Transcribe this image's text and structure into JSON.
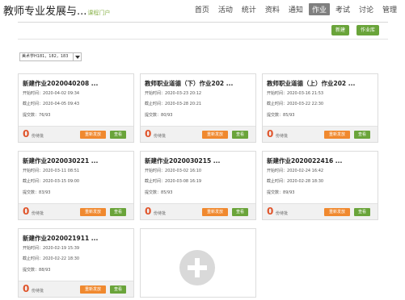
{
  "header": {
    "course_title": "教师专业发展与...",
    "course_subtitle": "课程门户",
    "nav": [
      {
        "label": "首页",
        "active": false
      },
      {
        "label": "活动",
        "active": false
      },
      {
        "label": "统计",
        "active": false
      },
      {
        "label": "资料",
        "active": false
      },
      {
        "label": "通知",
        "active": false
      },
      {
        "label": "作业",
        "active": true
      },
      {
        "label": "考试",
        "active": false
      },
      {
        "label": "讨论",
        "active": false
      },
      {
        "label": "管理",
        "active": false
      }
    ]
  },
  "toolbar": {
    "new_label": "新建",
    "library_label": "作业库"
  },
  "class_select": {
    "selected": "美术学H181，182，183"
  },
  "labels": {
    "start_prefix": "开始时间：",
    "end_prefix": "截止时间：",
    "submitted_prefix": "提交数：",
    "pending_label": "份待批",
    "publish_label": "重新发放",
    "view_label": "查看"
  },
  "cards": [
    {
      "title": "新建作业2020040208 ...",
      "start": "2020-04-02 09:34",
      "end": "2020-04-05 09:43",
      "submitted": "76/93",
      "pending": "0"
    },
    {
      "title": "教师职业道德（下）作业202 ...",
      "start": "2020-03-23 20:12",
      "end": "2020-03-28 20:21",
      "submitted": "80/93",
      "pending": "0"
    },
    {
      "title": "教师职业道德（上）作业202 ...",
      "start": "2020-03-16 21:53",
      "end": "2020-03-22 22:30",
      "submitted": "85/93",
      "pending": "0"
    },
    {
      "title": "新建作业2020030221 ...",
      "start": "2020-03-11 08:51",
      "end": "2020-03-15 09:00",
      "submitted": "83/93",
      "pending": "0"
    },
    {
      "title": "新建作业2020030215 ...",
      "start": "2020-03-02 16:10",
      "end": "2020-03-08 16:19",
      "submitted": "85/93",
      "pending": "0"
    },
    {
      "title": "新建作业2020022416 ...",
      "start": "2020-02-24 16:42",
      "end": "2020-02-28 18:30",
      "submitted": "89/93",
      "pending": "0"
    },
    {
      "title": "新建作业2020021911 ...",
      "start": "2020-02-19 15:39",
      "end": "2020-02-22 18:30",
      "submitted": "88/93",
      "pending": "0"
    }
  ]
}
